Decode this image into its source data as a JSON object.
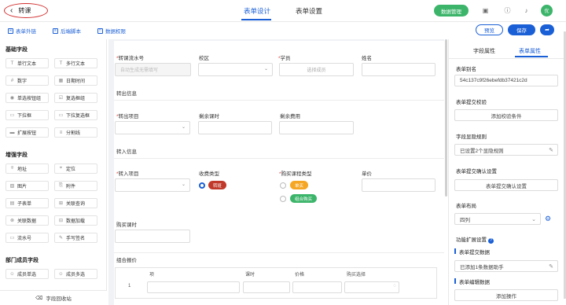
{
  "header": {
    "back_label": "转课",
    "tabs": [
      "表单设计",
      "表单设置"
    ],
    "data_manage": "数据管理",
    "avatar_text": "优"
  },
  "toolbar": {
    "links": [
      "表单外链",
      "后端脚本",
      "数据权限"
    ],
    "preview": "预览",
    "save": "保存"
  },
  "left_panel": {
    "basic_title": "基础字段",
    "basic": [
      "单行文本",
      "多行文本",
      "数字",
      "日期时间",
      "单选按钮组",
      "复选框组",
      "下拉框",
      "下拉复选框",
      "扩展按钮",
      "分割线"
    ],
    "enhanced_title": "增强字段",
    "enhanced": [
      "地址",
      "定位",
      "图片",
      "附件",
      "子表单",
      "关联查询",
      "关联数据",
      "数据加载",
      "流水号",
      "手写签名"
    ],
    "dept_title": "部门成员字段",
    "dept": [
      "成员单选",
      "成员多选"
    ],
    "recycle": "字段回收站"
  },
  "form": {
    "row1": {
      "serial_label": "转课流水号",
      "serial_placeholder": "自动生成无需填写",
      "campus_label": "校区",
      "student_label": "学员",
      "student_placeholder": "选择成员",
      "name_label": "姓名"
    },
    "out_section": "转出信息",
    "row2": {
      "out_item_label": "转出项目",
      "remain_hours_label": "剩余课时",
      "remain_fee_label": "剩余费用"
    },
    "in_section": "转入信息",
    "row3": {
      "in_item_label": "转入项目",
      "fee_type_label": "收费类型",
      "fee_option": "转班",
      "buy_type_label": "购买课程类型",
      "buy_options": [
        "单买",
        "组合购买"
      ],
      "price_label": "单价"
    },
    "buy_hours_label": "购买课时",
    "combo_label": "组合报价",
    "table_headers": [
      "项",
      "课时",
      "价格",
      "购买选择"
    ],
    "table_row_index": "1"
  },
  "right_panel": {
    "tabs": [
      "字段属性",
      "表单属性"
    ],
    "alias_label": "表单别名",
    "alias_value": "54c137c9f26ebefdb37421c2d",
    "validate_label": "表单提交校验",
    "validate_button": "添加校验条件",
    "display_label": "字段显隐规则",
    "display_value": "已设置2个显隐规则",
    "confirm_label": "表单提交确认设置",
    "confirm_button": "表单提交确认设置",
    "layout_label": "表单布局",
    "layout_value": "四列",
    "ext_label": "功能扩展设置",
    "submit_data_label": "表单提交数据",
    "submit_data_value": "已添加1条数据助手",
    "edit_data_label": "表单编辑数据",
    "add_op_button": "添加操作"
  },
  "colors": {
    "accent": "#1a5fd6",
    "green": "#3cb56a",
    "red": "#d32f2f",
    "orange": "#f5a623"
  }
}
